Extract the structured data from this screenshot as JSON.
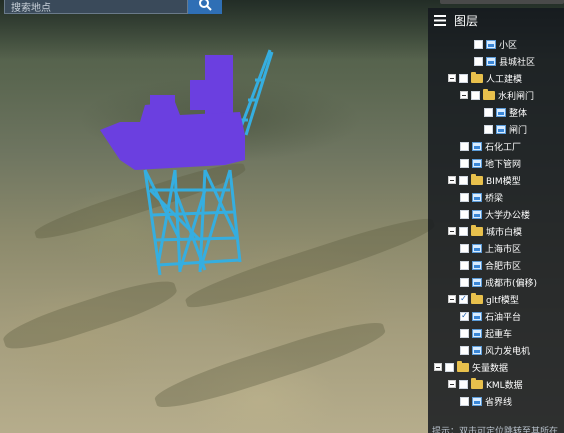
{
  "search": {
    "placeholder": "搜索地点",
    "button_icon": "search-icon"
  },
  "panel": {
    "title": "图层",
    "header_icon": "layers-icon",
    "hint": "提示：双击可定位跳转至其所在"
  },
  "tree": [
    {
      "label": "小区",
      "kind": "layer",
      "checked": false,
      "expandable": false
    },
    {
      "label": "县城社区",
      "kind": "layer",
      "checked": false,
      "expandable": false
    },
    {
      "label": "人工建模",
      "kind": "folder",
      "checked": false,
      "expandable": true
    },
    {
      "label": "水利闸门",
      "kind": "folder",
      "checked": false,
      "expandable": true
    },
    {
      "label": "整体",
      "kind": "layer",
      "checked": false,
      "expandable": false
    },
    {
      "label": "闸门",
      "kind": "layer",
      "checked": false,
      "expandable": false
    },
    {
      "label": "石化工厂",
      "kind": "layer",
      "checked": false,
      "expandable": false
    },
    {
      "label": "地下管网",
      "kind": "layer",
      "checked": false,
      "expandable": false
    },
    {
      "label": "BIM模型",
      "kind": "folder",
      "checked": false,
      "expandable": true
    },
    {
      "label": "桥梁",
      "kind": "layer",
      "checked": false,
      "expandable": false
    },
    {
      "label": "大学办公楼",
      "kind": "layer",
      "checked": false,
      "expandable": false
    },
    {
      "label": "城市白模",
      "kind": "folder",
      "checked": false,
      "expandable": true
    },
    {
      "label": "上海市区",
      "kind": "layer",
      "checked": false,
      "expandable": false
    },
    {
      "label": "合肥市区",
      "kind": "layer",
      "checked": false,
      "expandable": false
    },
    {
      "label": "成都市(偏移)",
      "kind": "layer",
      "checked": false,
      "expandable": false
    },
    {
      "label": "gltf模型",
      "kind": "folder",
      "checked": true,
      "expandable": true
    },
    {
      "label": "石油平台",
      "kind": "layer",
      "checked": true,
      "expandable": false
    },
    {
      "label": "起重车",
      "kind": "layer",
      "checked": false,
      "expandable": false
    },
    {
      "label": "风力发电机",
      "kind": "layer",
      "checked": false,
      "expandable": false
    },
    {
      "label": "矢量数据",
      "kind": "folder",
      "checked": false,
      "expandable": true
    },
    {
      "label": "KML数据",
      "kind": "folder",
      "checked": false,
      "expandable": true
    },
    {
      "label": "省界线",
      "kind": "layer",
      "checked": false,
      "expandable": false
    }
  ],
  "colors": {
    "platform_deck": "#6b3fe0",
    "platform_legs": "#35aee0",
    "panel_bg": "#141a20",
    "search_btn": "#2f6fb5"
  }
}
